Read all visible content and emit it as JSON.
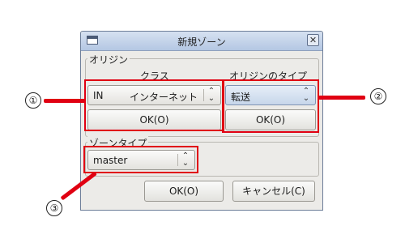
{
  "dialog": {
    "title": "新規ゾーン",
    "close_symbol": "✕"
  },
  "origin_group": {
    "label": "オリジン",
    "class_label": "クラス",
    "origin_type_label": "オリジンのタイプ",
    "class_combo": {
      "value1": "IN",
      "value2": "インターネット"
    },
    "class_ok": "OK(O)",
    "type_combo": {
      "value": "転送"
    },
    "type_ok": "OK(O)"
  },
  "zone_type_group": {
    "label": "ゾーンタイプ",
    "combo": {
      "value": "master"
    }
  },
  "buttons": {
    "ok": "OK(O)",
    "cancel": "キャンセル(C)"
  },
  "markers": [
    "①",
    "②",
    "③"
  ],
  "colors": {
    "annotation_red": "#e00012"
  },
  "icons": {
    "combo_arrows": "⌃⌄"
  }
}
